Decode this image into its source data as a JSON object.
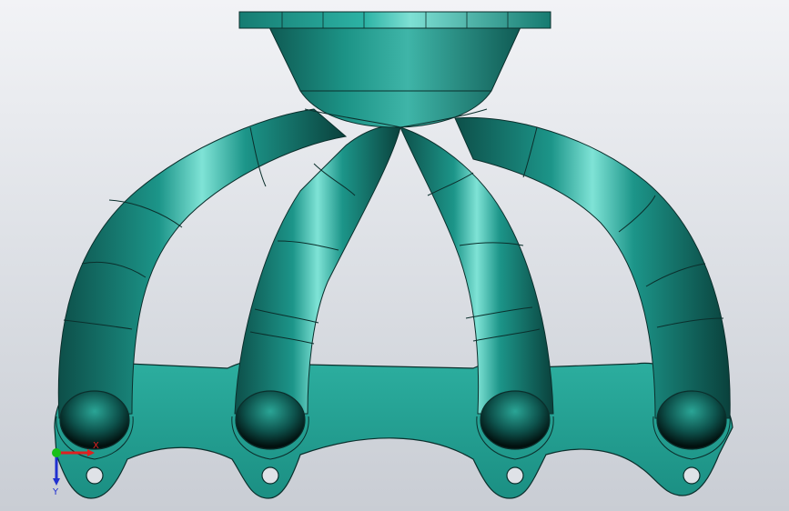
{
  "viewport": {
    "background_top": "#f2f3f6",
    "background_bottom": "#c9cdd4"
  },
  "model": {
    "body_color": "#1e9a8e",
    "edge_color": "#0b2f2c",
    "flange_color": "#2aa89b"
  },
  "triad": {
    "x_label": "X",
    "y_label": "Y",
    "x_color": "#e02020",
    "y_color": "#2030d0",
    "origin_color": "#18c018"
  }
}
